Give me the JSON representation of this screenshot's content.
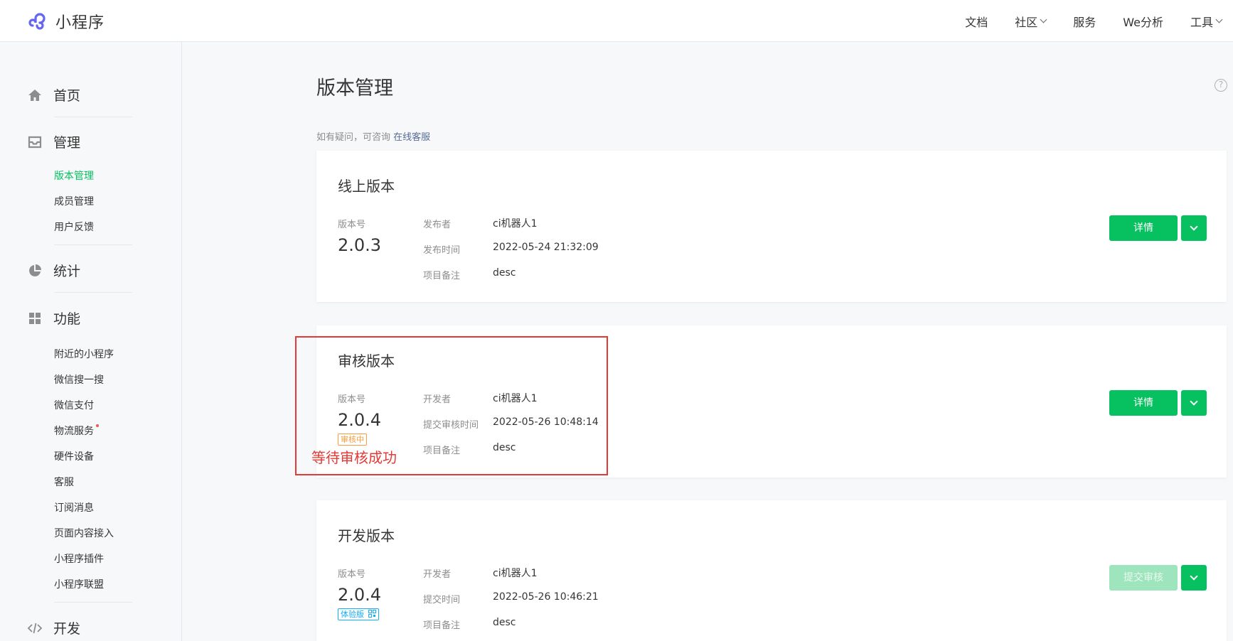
{
  "app": {
    "name": "小程序",
    "brand_color": "#6467f0"
  },
  "topnav": [
    "文档",
    "社区",
    "服务",
    "We分析",
    "工具"
  ],
  "sidebar": {
    "groups": [
      {
        "label": "首页",
        "icon": "home-icon"
      },
      {
        "label": "管理",
        "icon": "inbox-icon",
        "items": [
          "版本管理",
          "成员管理",
          "用户反馈"
        ]
      },
      {
        "label": "统计",
        "icon": "pie-chart-icon"
      },
      {
        "label": "功能",
        "icon": "grid-icon",
        "items": [
          "附近的小程序",
          "微信搜一搜",
          "微信支付",
          "物流服务",
          "硬件设备",
          "客服",
          "订阅消息",
          "页面内容接入",
          "小程序插件",
          "小程序联盟"
        ]
      },
      {
        "label": "开发",
        "icon": "code-icon"
      }
    ],
    "active_item": "版本管理"
  },
  "main": {
    "title": "版本管理",
    "notice_prefix": "如有疑问，可咨询",
    "notice_link": "在线客服",
    "version_label": "版本号",
    "cards": [
      {
        "title": "线上版本",
        "version": "2.0.3",
        "fields": [
          {
            "key": "发布者",
            "value": "ci机器人1"
          },
          {
            "key": "发布时间",
            "value": "2022-05-24 21:32:09"
          },
          {
            "key": "项目备注",
            "value": "desc"
          }
        ],
        "button": "详情"
      },
      {
        "title": "审核版本",
        "version": "2.0.4",
        "tag": "审核中",
        "fields": [
          {
            "key": "开发者",
            "value": "ci机器人1"
          },
          {
            "key": "提交审核时间",
            "value": "2022-05-26 10:48:14"
          },
          {
            "key": "项目备注",
            "value": "desc"
          }
        ],
        "button": "详情"
      },
      {
        "title": "开发版本",
        "version": "2.0.4",
        "tag": "体验版",
        "fields": [
          {
            "key": "开发者",
            "value": "ci机器人1"
          },
          {
            "key": "提交时间",
            "value": "2022-05-26 10:46:21"
          },
          {
            "key": "项目备注",
            "value": "desc"
          }
        ],
        "button": "提交审核"
      }
    ]
  },
  "annotation": {
    "text": "等待审核成功",
    "color": "#e53935"
  },
  "colors": {
    "primary": "#07c160",
    "primary_disabled": "#9ee5bd",
    "tag_review": "#fa9d3b",
    "tag_trial": "#10aeff",
    "link": "#576b95"
  },
  "help_icon": "?"
}
